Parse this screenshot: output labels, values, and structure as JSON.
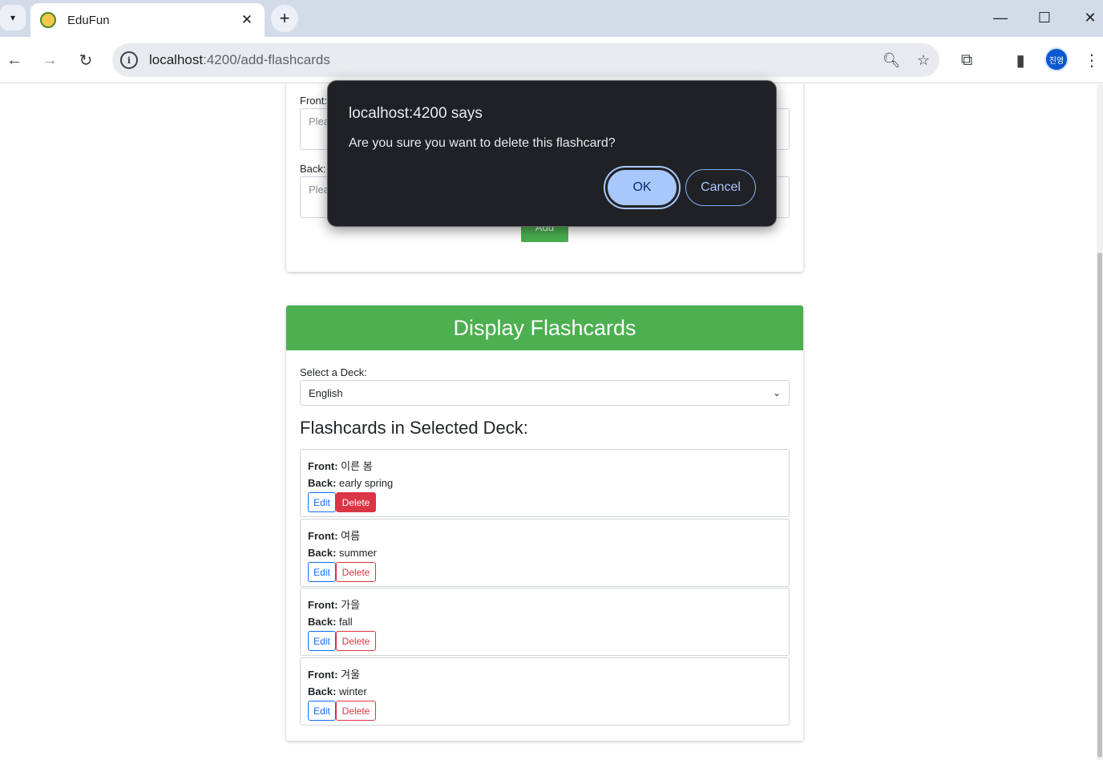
{
  "browser": {
    "tab_title": "EduFun",
    "url_host": "localhost",
    "url_rest": ":4200/add-flashcards",
    "avatar_text": "진영"
  },
  "add_form": {
    "front_label": "Front:",
    "front_placeholder": "Plea",
    "back_label": "Back:",
    "back_placeholder": "Plea",
    "add_button": "Add"
  },
  "display": {
    "header": "Display Flashcards",
    "deck_label": "Select a Deck:",
    "deck_selected": "English",
    "section_title": "Flashcards in Selected Deck:",
    "front_label": "Front:",
    "back_label": "Back:",
    "edit_label": "Edit",
    "delete_label": "Delete",
    "flashcards": [
      {
        "front": "이른 봄",
        "back": "early spring"
      },
      {
        "front": "여름",
        "back": "summer"
      },
      {
        "front": "가을",
        "back": "fall"
      },
      {
        "front": "겨울",
        "back": "winter"
      }
    ]
  },
  "dialog": {
    "title": "localhost:4200 says",
    "message": "Are you sure you want to delete this flashcard?",
    "ok": "OK",
    "cancel": "Cancel"
  },
  "colors": {
    "accent_green": "#4caf50",
    "danger_red": "#dc3545",
    "primary_blue": "#0d6efd",
    "dialog_bg": "#202124"
  }
}
